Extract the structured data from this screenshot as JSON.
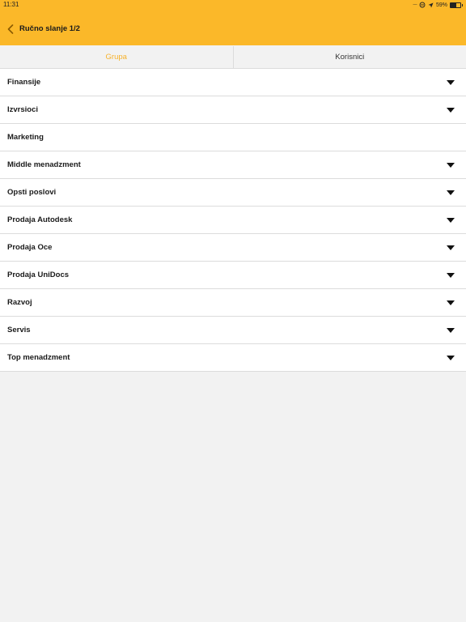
{
  "status_bar": {
    "time": "11:31",
    "battery_percent": "59%",
    "battery_level": 0.59
  },
  "header": {
    "title": "Ručno slanje 1/2",
    "back_icon": "chevron-left-icon"
  },
  "tabs": [
    {
      "label": "Grupa",
      "active": true
    },
    {
      "label": "Korisnici",
      "active": false
    }
  ],
  "groups": [
    {
      "label": "Finansije",
      "expandable": true
    },
    {
      "label": "Izvrsioci",
      "expandable": true
    },
    {
      "label": "Marketing",
      "expandable": false
    },
    {
      "label": "Middle menadzment",
      "expandable": true
    },
    {
      "label": "Opsti poslovi",
      "expandable": true
    },
    {
      "label": "Prodaja Autodesk",
      "expandable": true
    },
    {
      "label": "Prodaja Oce",
      "expandable": true
    },
    {
      "label": "Prodaja UniDocs",
      "expandable": true
    },
    {
      "label": "Razvoj",
      "expandable": true
    },
    {
      "label": "Servis",
      "expandable": true
    },
    {
      "label": "Top menadzment",
      "expandable": true
    }
  ],
  "colors": {
    "header_bg": "#fbb829",
    "active_tab": "#f7b22b",
    "page_bg": "#f2f2f2"
  }
}
